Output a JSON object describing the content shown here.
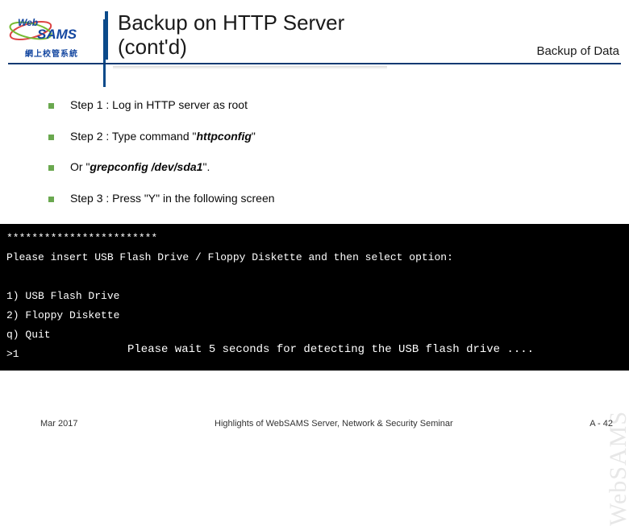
{
  "header": {
    "logo_text_top": "Web",
    "logo_text_main": "SAMS",
    "logo_sub": "網上校管系統",
    "title_line1": "Backup on HTTP Server",
    "title_line2": "(cont'd)",
    "subtitle": "Backup of Data"
  },
  "bullets": [
    {
      "prefix": "Step 1 : ",
      "plain": "Log in HTTP server as root",
      "em": ""
    },
    {
      "prefix": "Step 2 : ",
      "plain": "Type command \"",
      "em": "httpconfig",
      "suffix": "\""
    },
    {
      "prefix": "Or \"",
      "plain": "",
      "em": "grepconfig /dev/sda1",
      "suffix": "\"."
    },
    {
      "prefix": "Step 3 : ",
      "plain": "Press \"Y\" in the following screen",
      "em": ""
    }
  ],
  "terminal": {
    "stars": "************************",
    "prompt": "Please insert USB Flash Drive / Floppy Diskette and then select option:",
    "opt1": "1) USB Flash Drive",
    "opt2": "2) Floppy Diskette",
    "optq": "q) Quit",
    "input": ">1",
    "overlay": "Please wait 5 seconds for detecting the USB flash drive ...."
  },
  "footer": {
    "date": "Mar 2017",
    "center": "Highlights of WebSAMS Server, Network & Security Seminar",
    "page": "A - 42"
  },
  "watermark": "WebSAMS"
}
